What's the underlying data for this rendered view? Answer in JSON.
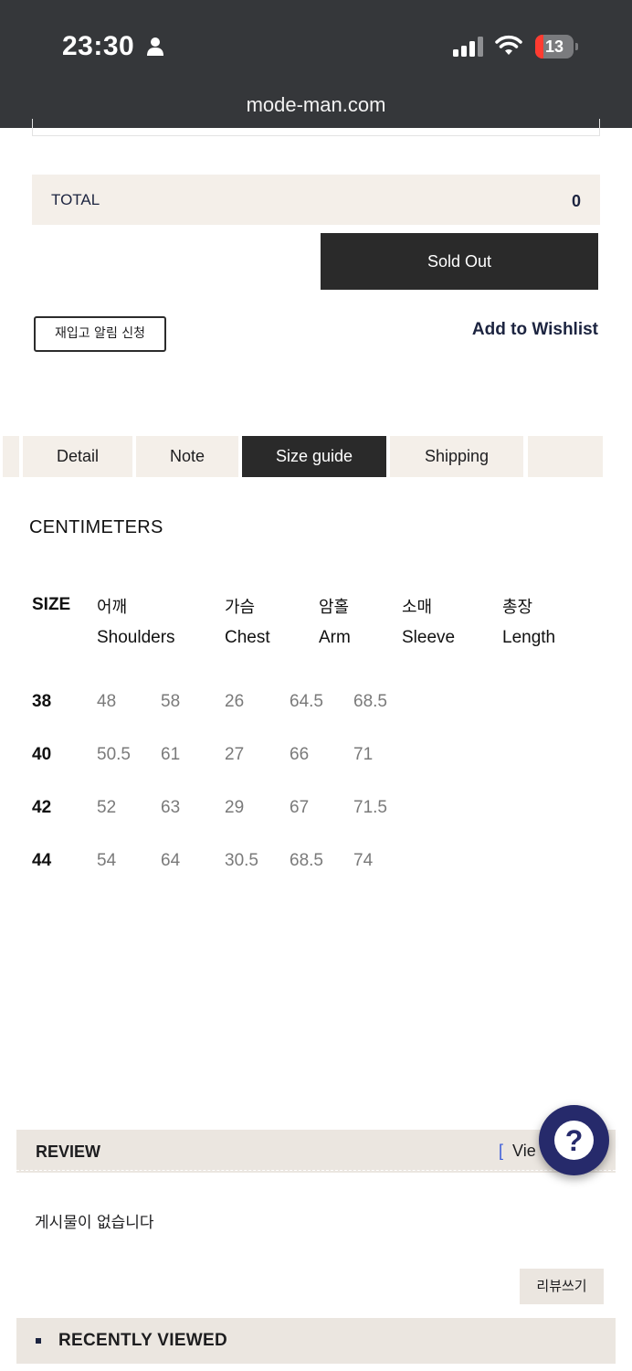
{
  "status_bar": {
    "time": "23:30",
    "battery": "13",
    "url": "mode-man.com"
  },
  "summary": {
    "total_label": "TOTAL",
    "total_value": "0",
    "sold_out_label": "Sold Out",
    "restock_label": "재입고 알림 신청",
    "wishlist_label": "Add to Wishlist"
  },
  "tabs": [
    {
      "label": "Detail",
      "active": false
    },
    {
      "label": "Note",
      "active": false
    },
    {
      "label": "Size guide",
      "active": true
    },
    {
      "label": "Shipping",
      "active": false
    }
  ],
  "size_guide": {
    "unit": "CENTIMETERS",
    "size_header": "SIZE",
    "columns": [
      {
        "ko": "어깨",
        "en": "Shoulders"
      },
      {
        "ko": "가슴",
        "en": "Chest"
      },
      {
        "ko": "암홀",
        "en": "Arm"
      },
      {
        "ko": "소매",
        "en": "Sleeve"
      },
      {
        "ko": "총장",
        "en": "Length"
      }
    ],
    "rows": [
      {
        "size": "38",
        "values": [
          "48",
          "58",
          "26",
          "64.5",
          "68.5"
        ]
      },
      {
        "size": "40",
        "values": [
          "50.5",
          "61",
          "27",
          "66",
          "71"
        ]
      },
      {
        "size": "42",
        "values": [
          "52",
          "63",
          "29",
          "67",
          "71.5"
        ]
      },
      {
        "size": "44",
        "values": [
          "54",
          "64",
          "30.5",
          "68.5",
          "74"
        ]
      }
    ]
  },
  "review": {
    "title": "REVIEW",
    "view_bracket": "[",
    "view_text": "Vie",
    "empty_text": "게시물이 없습니다",
    "write_label": "리뷰쓰기",
    "help_symbol": "?"
  },
  "recently_viewed": {
    "title": "RECENTLY VIEWED"
  }
}
